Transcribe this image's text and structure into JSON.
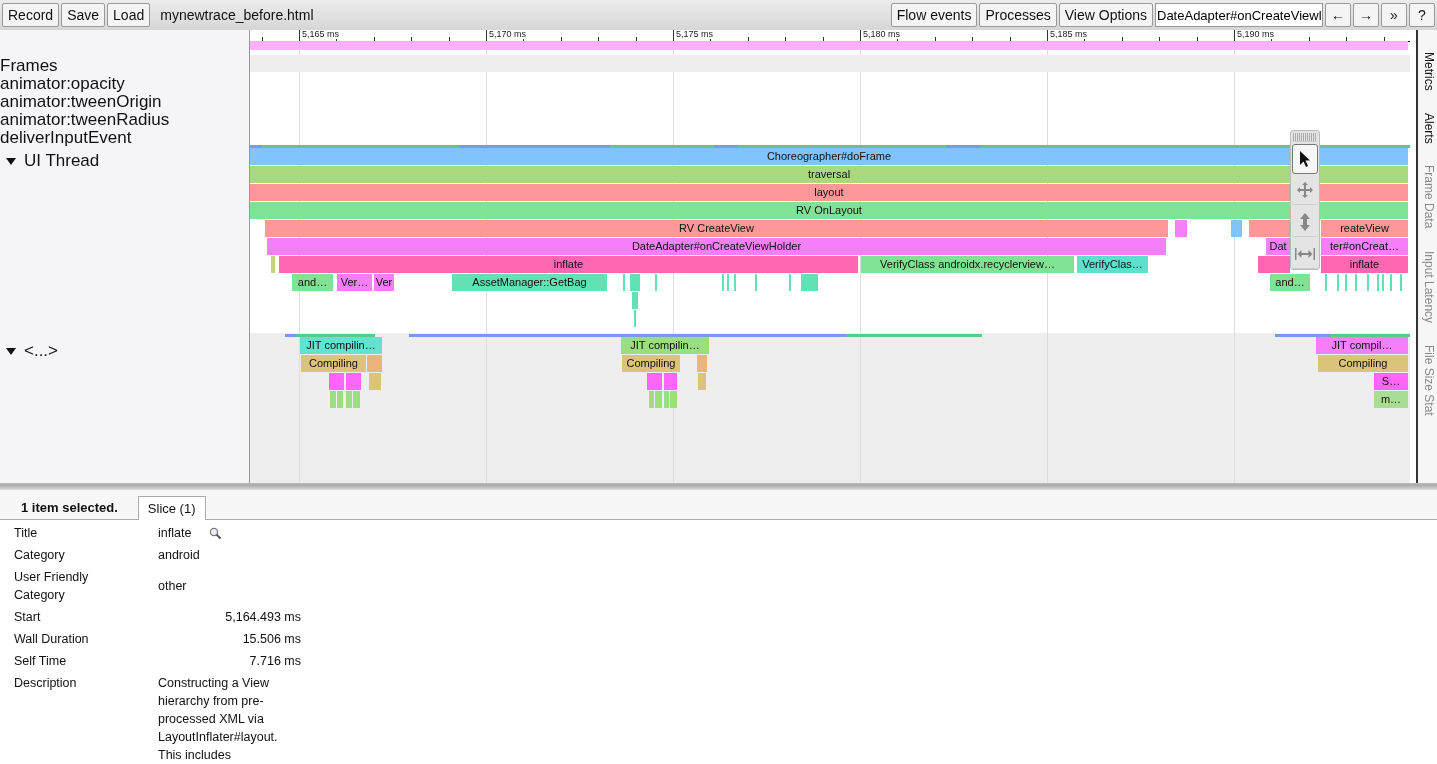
{
  "toolbar": {
    "buttons": [
      "Record",
      "Save",
      "Load"
    ],
    "filename": "mynewtrace_before.html",
    "right_buttons": [
      "Flow events",
      "Processes",
      "View Options"
    ],
    "search": {
      "value": "DateAdapter#onCreateViewl"
    },
    "nav": [
      "←",
      "→",
      "»",
      "?"
    ]
  },
  "ruler": {
    "ticks": [
      "5,165 ms",
      "5,170 ms",
      "5,175 ms",
      "5,180 ms",
      "5,185 ms",
      "5,190 ms"
    ]
  },
  "track_labels": [
    "Frames",
    "animator:opacity",
    "animator:tweenOrigin",
    "animator:tweenRadius",
    "deliverInputEvent"
  ],
  "threads": [
    {
      "label": "UI Thread",
      "expanded": true,
      "rows": [
        {
          "slices": [
            {
              "label": "Choreographer#doFrame",
              "color": "#80c4fe"
            }
          ]
        },
        {
          "slices": [
            {
              "label": "traversal",
              "color": "#a9d97d"
            }
          ]
        },
        {
          "slices": [
            {
              "label": "layout",
              "color": "#fe9898"
            }
          ]
        },
        {
          "slices": [
            {
              "label": "RV OnLayout",
              "color": "#80e393"
            }
          ]
        },
        {
          "slices": [
            {
              "label": "RV CreateView",
              "color": "#fe9898"
            },
            {
              "color": "#f47ff8"
            },
            {
              "color": "#80c4fe"
            },
            {
              "label_2": "reateView",
              "color": "#fe9898"
            }
          ]
        },
        {
          "slices": [
            {
              "label": "DateAdapter#onCreateViewHolder",
              "color": "#f47ff8"
            },
            {
              "label": "Dat",
              "label_2": "ter#onCreat…",
              "color": "#f47ff8"
            }
          ]
        },
        {
          "slices": [
            {
              "color": "#c0d47a"
            },
            {
              "label": "inflate",
              "color": "#ff66b3"
            },
            {
              "label": "VerifyClass androidx.recyclerview…",
              "color": "#80e393"
            },
            {
              "label": "VerifyClas…",
              "color": "#5fe0cf"
            },
            {
              "label_2": "inflate",
              "color": "#ff66b3"
            }
          ]
        },
        {
          "slices": [
            {
              "label": "and…",
              "color": "#80e393"
            },
            {
              "label": "Ver…",
              "color": "#f47ff8"
            },
            {
              "label": "Ver",
              "color": "#f47ff8"
            },
            {
              "label": "AssetManager::GetBag",
              "color": "#62e2b4"
            },
            {
              "color": "#62e2b4"
            },
            {
              "color": "#62e2b4"
            },
            {
              "color": "#62e2b4"
            },
            {
              "color": "#62e2b4"
            },
            {
              "color": "#62e2b4"
            },
            {
              "color": "#62e2b4"
            },
            {
              "color": "#62e2b4"
            },
            {
              "color": "#62e2b4"
            },
            {
              "color": "#62e2b4"
            },
            {
              "label": "and…",
              "color": "#80e393"
            },
            {
              "color": "#62e2b4"
            },
            {
              "color": "#62e2b4"
            },
            {
              "color": "#62e2b4"
            },
            {
              "color": "#62e2b4"
            },
            {
              "color": "#62e2b4"
            },
            {
              "color": "#62e2b4"
            },
            {
              "color": "#62e2b4"
            },
            {
              "color": "#62e2b4"
            },
            {
              "color": "#62e2b4"
            }
          ]
        },
        {
          "slices": [
            {
              "color": "#62e2b4"
            }
          ]
        },
        {
          "slices": [
            {
              "color": "#62e2b4"
            }
          ]
        }
      ]
    },
    {
      "label": "<...>",
      "expanded": true,
      "rows": [
        {
          "slices": [
            {
              "label": "JIT compilin…",
              "color": "#62e2cf"
            },
            {
              "label": "JIT compilin…",
              "color": "#9ade80"
            },
            {
              "label": "JIT compil…",
              "color": "#f47ff8"
            }
          ]
        },
        {
          "slices": [
            {
              "label": "Compiling",
              "color": "#dbc379"
            },
            {
              "color": "#ebb47c"
            },
            {
              "label": "Compiling",
              "color": "#dbc379"
            },
            {
              "color": "#ebb47c"
            },
            {
              "label": "Compiling",
              "color": "#dbc379"
            }
          ]
        },
        {
          "slices": [
            {
              "color": "#ff66f8"
            },
            {
              "color": "#ff66f8"
            },
            {
              "color": "#dbc379"
            },
            {
              "color": "#ff66f8"
            },
            {
              "color": "#ff66f8"
            },
            {
              "color": "#dbc379"
            },
            {
              "label": "S…",
              "color": "#ff66f8"
            }
          ]
        },
        {
          "slices": [
            {
              "color": "#9ade80"
            },
            {
              "color": "#9ade80"
            },
            {
              "color": "#9ade80"
            },
            {
              "color": "#9ade80"
            },
            {
              "color": "#9ade80"
            },
            {
              "color": "#9ade80"
            },
            {
              "color": "#9ade80"
            },
            {
              "color": "#9ade80"
            },
            {
              "label": "m…",
              "color": "#a8dd93"
            }
          ]
        }
      ]
    }
  ],
  "mode_tools": [
    {
      "kind": "select",
      "selected": true
    },
    {
      "kind": "pan",
      "selected": false
    },
    {
      "kind": "zoom",
      "selected": false
    },
    {
      "kind": "timing",
      "selected": false
    }
  ],
  "side_tabs": [
    {
      "label": "Metrics",
      "disabled": false
    },
    {
      "label": "Alerts",
      "disabled": false
    },
    {
      "label": "Frame Data",
      "disabled": true
    },
    {
      "label": "Input Latency",
      "disabled": true
    },
    {
      "label": "File Size Stat",
      "disabled": true
    }
  ],
  "details": {
    "header": "1 item selected.",
    "tabs": [
      {
        "label": "Slice (1)",
        "selected": true
      }
    ],
    "rows": [
      {
        "name": "Title",
        "value": "inflate",
        "kind": "title"
      },
      {
        "name": "Category",
        "value": "android",
        "kind": "text"
      },
      {
        "name": "User Friendly Category",
        "value": "other",
        "kind": "text"
      },
      {
        "name": "Start",
        "value": "5,164.493 ms",
        "kind": "number"
      },
      {
        "name": "Wall Duration",
        "value": "15.506 ms",
        "kind": "number"
      },
      {
        "name": "Self Time",
        "value": "7.716 ms",
        "kind": "number"
      },
      {
        "name": "Description",
        "value": "Constructing a View hierarchy from pre-processed XML via LayoutInflater#layout. This includes",
        "kind": "text"
      }
    ]
  }
}
